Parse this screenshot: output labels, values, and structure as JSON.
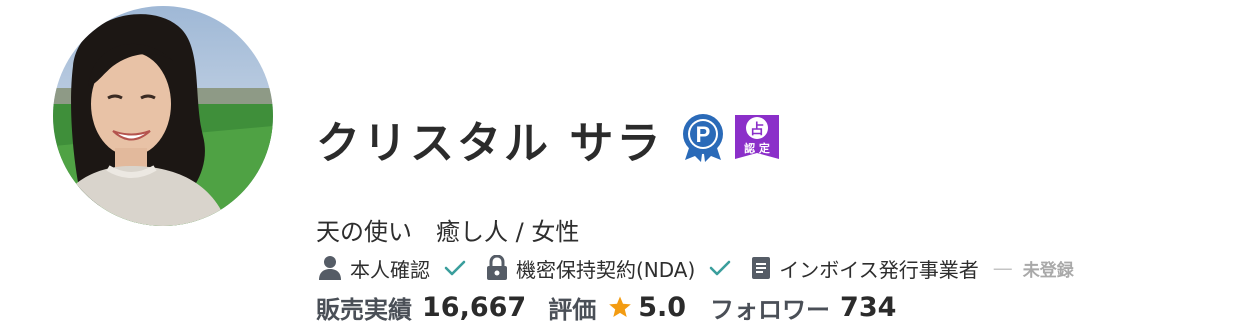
{
  "profile": {
    "name": "クリスタル サラ",
    "tagline": "天の使い　癒し人 / 女性",
    "badges": {
      "platinum": "P",
      "certified_top": "占",
      "certified_bottom": "認 定"
    }
  },
  "verifications": {
    "identity": {
      "label": "本人確認",
      "icon": "person-icon",
      "status_icon": "check-icon"
    },
    "nda": {
      "label": "機密保持契約(NDA)",
      "icon": "lock-icon",
      "status_icon": "check-icon"
    },
    "invoice": {
      "label": "インボイス発行事業者",
      "icon": "document-icon",
      "status": "未登録"
    }
  },
  "stats": {
    "sales_label": "販売実績",
    "sales_value": "16,667",
    "rating_label": "評価",
    "rating_value": "5.0",
    "followers_label": "フォロワー",
    "followers_value": "734"
  },
  "colors": {
    "check": "#3a9e9c",
    "icon_gray": "#555c66",
    "star": "#f39c12",
    "badge_blue": "#2a6ab8",
    "badge_purple": "#8b2fc9"
  }
}
